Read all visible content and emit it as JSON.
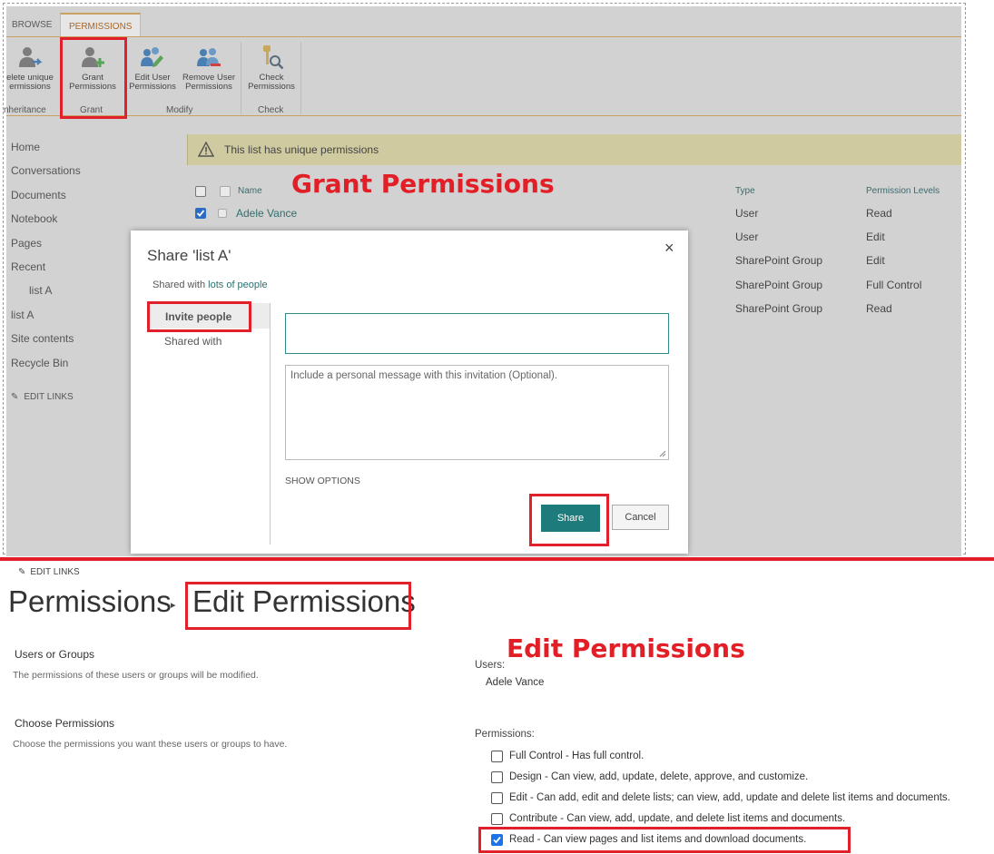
{
  "ribbon": {
    "tabs": [
      "BROWSE",
      "PERMISSIONS"
    ],
    "buttons": {
      "delete_unique": [
        "elete unique",
        "ermissions"
      ],
      "grant": [
        "Grant",
        "Permissions"
      ],
      "edit_user": [
        "Edit User",
        "Permissions"
      ],
      "remove_user": [
        "Remove User",
        "Permissions"
      ],
      "check": [
        "Check",
        "Permissions"
      ]
    },
    "groups": [
      "nheritance",
      "Grant",
      "Modify",
      "Check"
    ]
  },
  "left_nav": {
    "items": [
      "Home",
      "Conversations",
      "Documents",
      "Notebook",
      "Pages",
      "Recent",
      "list A",
      "list A",
      "Site contents",
      "Recycle Bin"
    ],
    "edit_links": "EDIT LINKS"
  },
  "warning": "This list has unique permissions",
  "table": {
    "headers": {
      "name": "Name",
      "type": "Type",
      "levels": "Permission Levels"
    },
    "first_name": "Adele Vance",
    "rows": [
      {
        "type": "User",
        "level": "Read"
      },
      {
        "type": "User",
        "level": "Edit"
      },
      {
        "type": "SharePoint Group",
        "level": "Edit"
      },
      {
        "type": "SharePoint Group",
        "level": "Full Control"
      },
      {
        "type": "SharePoint Group",
        "level": "Read"
      }
    ]
  },
  "dialog": {
    "title": "Share 'list A'",
    "close": "×",
    "shared_prefix": "Shared with",
    "shared_link": "lots of people",
    "tab_invite": "Invite people",
    "tab_shared": "Shared with",
    "message_placeholder": "Include a personal message with this invitation (Optional).",
    "show_options": "SHOW OPTIONS",
    "share_button": "Share",
    "cancel_button": "Cancel"
  },
  "annotations": {
    "grant_title": "Grant Permissions",
    "edit_title": "Edit Permissions"
  },
  "edit_page": {
    "edit_links": "EDIT LINKS",
    "breadcrumb_root": "Permissions",
    "breadcrumb_sep": "▸",
    "breadcrumb_current": "Edit Permissions",
    "users_groups_title": "Users or Groups",
    "users_groups_desc": "The permissions of these users or groups will be modified.",
    "choose_title": "Choose Permissions",
    "choose_desc": "Choose the permissions you want these users or groups to have.",
    "users_label": "Users:",
    "user_name": "Adele Vance",
    "permissions_label": "Permissions:",
    "options": [
      {
        "label": "Full Control - Has full control.",
        "checked": false
      },
      {
        "label": "Design - Can view, add, update, delete, approve, and customize.",
        "checked": false
      },
      {
        "label": "Edit - Can add, edit and delete lists; can view, add, update and delete list items and documents.",
        "checked": false
      },
      {
        "label": "Contribute - Can view, add, update, and delete list items and documents.",
        "checked": false
      },
      {
        "label": "Read - Can view pages and list items and download documents.",
        "checked": true
      }
    ]
  }
}
